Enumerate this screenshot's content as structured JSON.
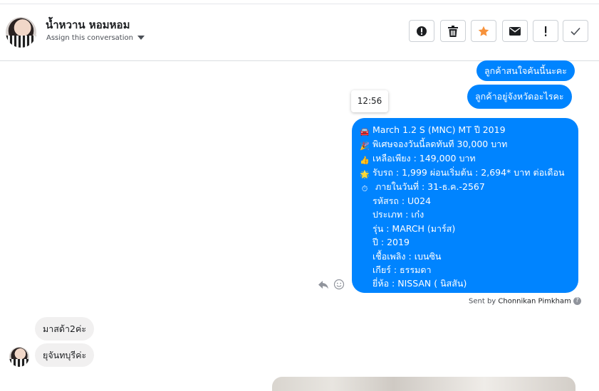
{
  "header": {
    "contact_name": "น้ำหวาน หอมหอม",
    "assign_label": "Assign this conversation",
    "toolbar": [
      {
        "name": "spam-button",
        "icon": "alert-circle-icon"
      },
      {
        "name": "delete-button",
        "icon": "trash-icon"
      },
      {
        "name": "star-button",
        "icon": "star-icon"
      },
      {
        "name": "mark-unread-button",
        "icon": "envelope-icon"
      },
      {
        "name": "follow-up-button",
        "icon": "exclamation-icon"
      },
      {
        "name": "done-button",
        "icon": "checkmark-icon"
      }
    ]
  },
  "messages": {
    "out_1": "ลูกค้าสนใจคันนี้นะคะ",
    "out_2": "ลูกค้าอยู่จังหวัดอะไรคะ",
    "timestamp": "12:56",
    "listing": {
      "lines": [
        {
          "emoji": "car-icon",
          "text": "March 1.2 S (MNC) MT ปี 2019"
        },
        {
          "emoji": "party-popper-icon",
          "text": "พิเศษจองวันนี้ลดทันที 30,000 บาท"
        },
        {
          "emoji": "thumbs-up-icon",
          "text": "เหลือเพียง : 149,000 บาท"
        },
        {
          "emoji": "sun-icon",
          "text": "รับรถ : 1,999 ผ่อนเริ่มต้น : 2,694* บาท ต่อเดือน"
        },
        {
          "emoji": "timer-clock-icon",
          "text": " ภายในวันที่ : 31-ธ.ค.-2567"
        },
        {
          "emoji": "",
          "text": "รหัสรถ : U024"
        },
        {
          "emoji": "",
          "text": "ประเภท : เก๋ง"
        },
        {
          "emoji": "",
          "text": "รุ่น : MARCH (มาร์ส)"
        },
        {
          "emoji": "",
          "text": "ปี : 2019"
        },
        {
          "emoji": "",
          "text": "เชื้อเพลิง : เบนซิน"
        },
        {
          "emoji": "",
          "text": "เกียร์ : ธรรมดา"
        },
        {
          "emoji": "",
          "text": "ยี่ห้อ : NISSAN ( นิสสัน)"
        }
      ]
    },
    "sent_by_prefix": "Sent by",
    "sent_by_name": "Chonnikan Pimkham",
    "in_1": "มาสด้า2ค่ะ",
    "in_2": "ยุจันทบุรีค่ะ"
  },
  "colors": {
    "outgoing_bubble": "#0084ff",
    "incoming_bubble": "#f1f0f0",
    "star": "#f7923b"
  }
}
